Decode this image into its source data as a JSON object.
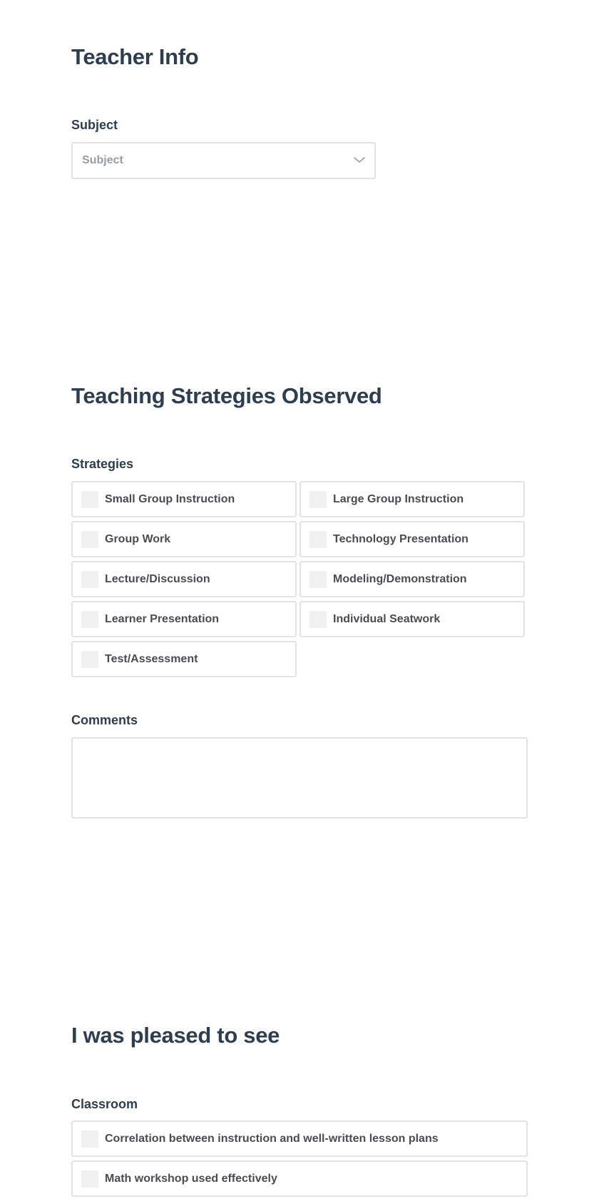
{
  "sections": {
    "teacher_info": {
      "title": "Teacher Info",
      "subject": {
        "label": "Subject",
        "placeholder": "Subject",
        "value": ""
      }
    },
    "strategies_observed": {
      "title": "Teaching Strategies Observed",
      "strategies": {
        "label": "Strategies",
        "options": [
          {
            "label": "Small Group Instruction",
            "checked": false
          },
          {
            "label": "Large Group Instruction",
            "checked": false
          },
          {
            "label": "Group Work",
            "checked": false
          },
          {
            "label": "Technology Presentation",
            "checked": false
          },
          {
            "label": "Lecture/Discussion",
            "checked": false
          },
          {
            "label": "Modeling/Demonstration",
            "checked": false
          },
          {
            "label": "Learner Presentation",
            "checked": false
          },
          {
            "label": "Individual Seatwork",
            "checked": false
          },
          {
            "label": "Test/Assessment",
            "checked": false
          }
        ]
      },
      "comments": {
        "label": "Comments",
        "value": ""
      }
    },
    "pleased_to_see": {
      "title": "I was pleased to see",
      "classroom": {
        "label": "Classroom",
        "options": [
          {
            "label": "Correlation between instruction and well-written lesson plans",
            "checked": false
          },
          {
            "label": "Math workshop used effectively",
            "checked": false
          }
        ]
      }
    }
  },
  "colors": {
    "heading": "#2c3e50",
    "option_text": "#4a4b55",
    "placeholder_text": "#9a9ca3",
    "border": "#e2e2e2",
    "checkbox_fill": "#f1f1f1"
  }
}
